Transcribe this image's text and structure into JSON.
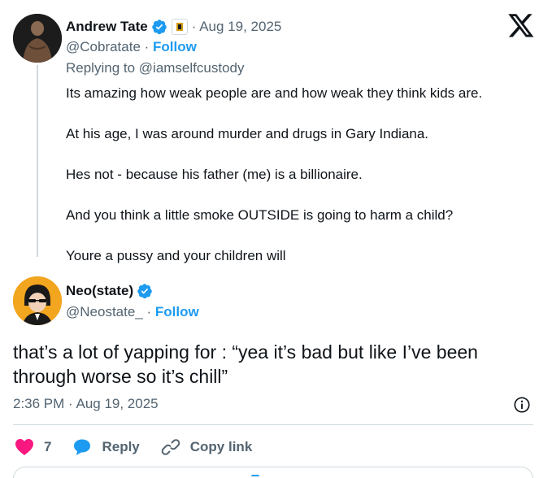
{
  "parent_tweet": {
    "author_name": "Andrew Tate",
    "date": "· Aug 19, 2025",
    "handle": "@Cobratate",
    "separator": " · ",
    "follow_label": "Follow",
    "replying_prefix": "Replying to ",
    "replying_handle": "@iamselfcustody",
    "lines": [
      "Its amazing how weak people are and how weak they think kids are.",
      "At his age, I was around murder and drugs in Gary Indiana.",
      "Hes not - because his father (me) is a billionaire.",
      "And you think a little smoke OUTSIDE is going to harm a child?",
      "Youre a pussy and your children will"
    ]
  },
  "main_tweet": {
    "author_name": "Neo(state)",
    "handle": "@Neostate_",
    "separator": " · ",
    "follow_label": "Follow",
    "text": "that’s a lot of yapping for : “yea it’s bad but like I’ve been through worse so it’s chill”",
    "timestamp": "2:36 PM · Aug 19, 2025"
  },
  "actions": {
    "like_count": "7",
    "reply_label": "Reply",
    "copy_link_label": "Copy link"
  },
  "colors": {
    "accent": "#1d9bf0",
    "like": "#f91880",
    "muted": "#536471",
    "text": "#0f1419",
    "border": "#cfd9de"
  },
  "icons": [
    "x-logo-icon",
    "verified-icon",
    "affiliate-badge-icon",
    "info-icon",
    "heart-icon",
    "reply-bubble-icon",
    "link-icon"
  ]
}
